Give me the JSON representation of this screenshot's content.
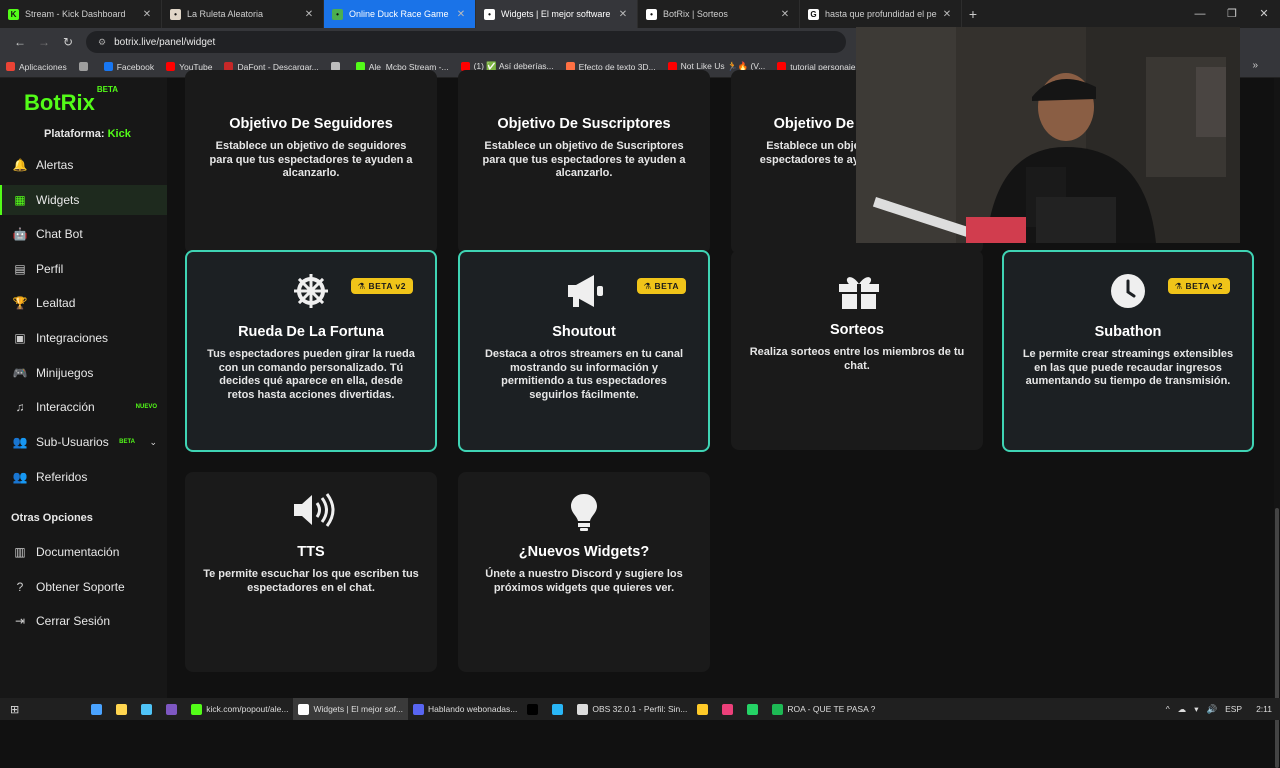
{
  "browser": {
    "tabs": [
      {
        "title": "Stream - Kick Dashboard",
        "favicon_color": "#53fc18",
        "favicon": "K"
      },
      {
        "title": "La Ruleta Aleatoria",
        "favicon_color": "#e0d6c8",
        "favicon": "•"
      },
      {
        "title": "Online Duck Race Game",
        "favicon_color": "#4caf50",
        "favicon": "•"
      },
      {
        "title": "Widgets | El mejor software para",
        "favicon_color": "#ffffff",
        "favicon": "•"
      },
      {
        "title": "BotRix | Sorteos",
        "favicon_color": "#ffffff",
        "favicon": "•"
      },
      {
        "title": "hasta que profundidad el pene",
        "favicon_color": "#ffffff",
        "favicon": "G"
      }
    ],
    "new_tab": "+",
    "url": "botrix.live/panel/widget",
    "bookmarks": [
      {
        "label": "Aplicaciones",
        "color": "#ea4335"
      },
      {
        "label": "",
        "color": "#9e9e9e"
      },
      {
        "label": "Facebook",
        "color": "#1877f2"
      },
      {
        "label": "YouTube",
        "color": "#ff0000"
      },
      {
        "label": "DaFont - Descargar...",
        "color": "#c62828"
      },
      {
        "label": "",
        "color": "#bdbdbd"
      },
      {
        "label": "Ale_Mcbo Stream -...",
        "color": "#53fc18"
      },
      {
        "label": "(1) ✅ Así deberías...",
        "color": "#ff0000"
      },
      {
        "label": "Efecto de texto 3D...",
        "color": "#ff7043"
      },
      {
        "label": "Not Like Us 🏃🔥 (V...",
        "color": "#ff0000"
      },
      {
        "label": "tutorial personaje 3...",
        "color": "#ff0000"
      }
    ]
  },
  "sidebar": {
    "logo": "BotRix",
    "logo_tag": "BETA",
    "platform_label": "Plataforma:",
    "platform_value": "Kick",
    "items": [
      {
        "label": "Alertas",
        "icon": "bell-icon",
        "glyph": "🔔"
      },
      {
        "label": "Widgets",
        "icon": "grid-icon",
        "glyph": "▦"
      },
      {
        "label": "Chat Bot",
        "icon": "robot-icon",
        "glyph": "🤖"
      },
      {
        "label": "Perfil",
        "icon": "id-card-icon",
        "glyph": "▤"
      },
      {
        "label": "Lealtad",
        "icon": "trophy-icon",
        "glyph": "🏆"
      },
      {
        "label": "Integraciones",
        "icon": "puzzle-icon",
        "glyph": "▣"
      },
      {
        "label": "Minijuegos",
        "icon": "gamepad-icon",
        "glyph": "🎮"
      },
      {
        "label": "Interacción",
        "icon": "music-icon",
        "glyph": "♫",
        "tag": "NUEVO"
      },
      {
        "label": "Sub-Usuarios",
        "icon": "users-icon",
        "glyph": "👥",
        "tag": "BETA"
      },
      {
        "label": "Referidos",
        "icon": "user-group-icon",
        "glyph": "👥"
      }
    ],
    "section_label": "Otras Opciones",
    "other_items": [
      {
        "label": "Documentación",
        "icon": "book-icon",
        "glyph": "▥"
      },
      {
        "label": "Obtener Soporte",
        "icon": "question-icon",
        "glyph": "?"
      },
      {
        "label": "Cerrar Sesión",
        "icon": "logout-icon",
        "glyph": "⇥"
      }
    ]
  },
  "cards": [
    {
      "title": "Objetivo De Seguidores",
      "desc": "Establece un objetivo de seguidores para que tus espectadores te ayuden a alcanzarlo.",
      "icon": "",
      "badge": ""
    },
    {
      "title": "Objetivo De Suscriptores",
      "desc": "Establece un objetivo de Suscriptores para que tus espectadores te ayuden a alcanzarlo.",
      "icon": "",
      "badge": ""
    },
    {
      "title": "Objetivo De Donaciones",
      "desc": "Establece un objetivo para que tus espectadores te ayuden a alcanzarlo.",
      "icon": "",
      "badge": ""
    },
    {
      "title": "Rueda De La Fortuna",
      "desc": "Tus espectadores pueden girar la rueda con un comando personalizado. Tú decides qué aparece en ella, desde retos hasta acciones divertidas.",
      "icon": "helm-icon",
      "badge": "BETA v2"
    },
    {
      "title": "Shoutout",
      "desc": "Destaca a otros streamers en tu canal mostrando su información y permitiendo a tus espectadores seguirlos fácilmente.",
      "icon": "megaphone-icon",
      "badge": "BETA"
    },
    {
      "title": "Sorteos",
      "desc": "Realiza sorteos entre los miembros de tu chat.",
      "icon": "gift-icon",
      "badge": ""
    },
    {
      "title": "Subathon",
      "desc": "Le permite crear streamings extensibles en las que puede recaudar ingresos aumentando su tiempo de transmisión.",
      "icon": "clock-icon",
      "badge": "BETA v2"
    },
    {
      "title": "TTS",
      "desc": "Te permite escuchar los que escriben tus espectadores en el chat.",
      "icon": "speaker-icon",
      "badge": ""
    },
    {
      "title": "¿Nuevos Widgets?",
      "desc": "Únete a nuestro Discord y sugiere los próximos widgets que quieres ver.",
      "icon": "lightbulb-icon",
      "badge": ""
    }
  ],
  "taskbar": {
    "items": [
      {
        "label": "",
        "color": "#4aa3ff"
      },
      {
        "label": "",
        "color": "#ffd54f"
      },
      {
        "label": "",
        "color": "#4fc3f7"
      },
      {
        "label": "",
        "color": "#7e57c2"
      },
      {
        "label": "kick.com/popout/ale...",
        "color": "#53fc18"
      },
      {
        "label": "Widgets | El mejor sof...",
        "color": "#ffffff"
      },
      {
        "label": "Hablando webonadas...",
        "color": "#5865f2"
      },
      {
        "label": "",
        "color": "#000000"
      },
      {
        "label": "",
        "color": "#29b6f6"
      },
      {
        "label": "OBS 32.0.1 - Perfil: Sin...",
        "color": "#dddddd"
      },
      {
        "label": "",
        "color": "#ffca28"
      },
      {
        "label": "",
        "color": "#ec407a"
      },
      {
        "label": "",
        "color": "#25d366"
      },
      {
        "label": "ROA - QUE TE PASA ?",
        "color": "#1db954"
      }
    ],
    "lang": "ESP",
    "time": "2:11"
  }
}
